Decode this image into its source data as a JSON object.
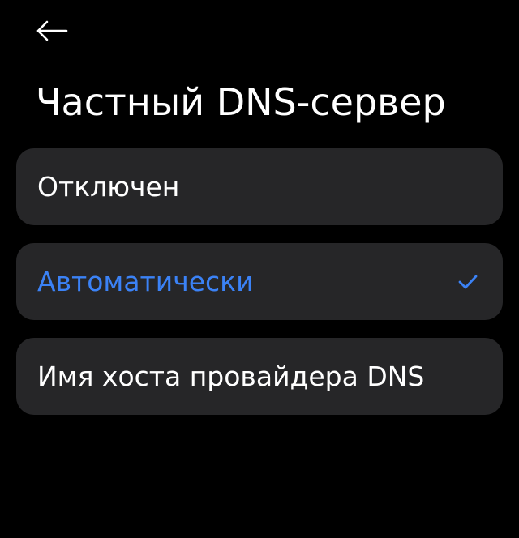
{
  "header": {
    "back_icon": "arrow-left-icon",
    "title": "Частный DNS-сервер"
  },
  "options": [
    {
      "label": "Отключен",
      "selected": false
    },
    {
      "label": "Автоматически",
      "selected": true
    },
    {
      "label": "Имя хоста провайдера DNS",
      "selected": false
    }
  ],
  "check_icon": "checkmark-icon",
  "colors": {
    "background": "#000000",
    "card": "#262628",
    "text": "#ffffff",
    "accent": "#3b82f6"
  }
}
